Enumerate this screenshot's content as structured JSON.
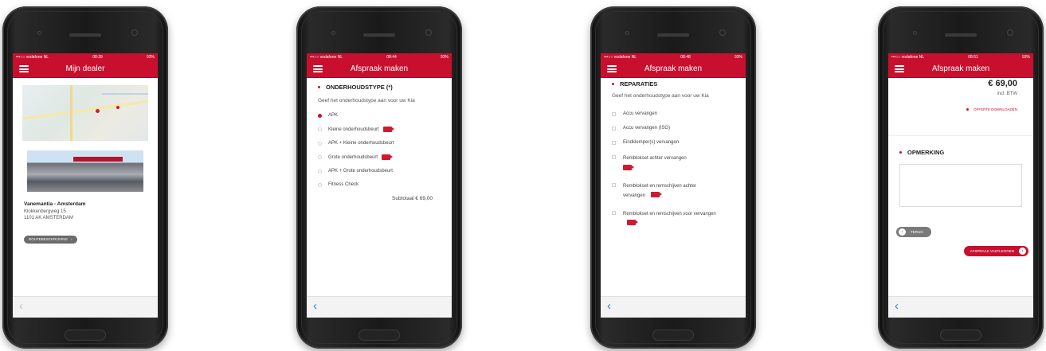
{
  "colors": {
    "accent": "#c8102e",
    "link_blue": "#2a7de1",
    "background": "#ffffff"
  },
  "phones": [
    {
      "status": {
        "left": "•••○○ vodafone NL",
        "time": "08:39",
        "right": "93%"
      },
      "title": "Mijn dealer",
      "dealer": {
        "name": "Vanemantia - Amsterdam",
        "street": "Klokkenbergweg 15",
        "city": "1101 AK AMSTERDAM",
        "route_button": "ROUTEBESCHRIJVING"
      }
    },
    {
      "status": {
        "left": "•••○○ vodafone NL",
        "time": "08:44",
        "right": "93%"
      },
      "title": "Afspraak maken",
      "section_title": "ONDERHOUDSTYPE (*)",
      "description": "Geef het onderhoudstype aan voor uw Kia",
      "options": [
        {
          "label": "APK",
          "selected": true,
          "video": false
        },
        {
          "label": "Kleine onderhoudsbeurt",
          "selected": false,
          "video": true
        },
        {
          "label": "APK + Kleine onderhoudsbeurt",
          "selected": false,
          "video": false
        },
        {
          "label": "Grote onderhoudsbeurt",
          "selected": false,
          "video": true
        },
        {
          "label": "APK + Grote onderhoudsbeurt",
          "selected": false,
          "video": false
        },
        {
          "label": "Fitness Check",
          "selected": false,
          "video": false
        }
      ],
      "subtotal": "Subtotaal € 69,00"
    },
    {
      "status": {
        "left": "•••○○ vodafone NL",
        "time": "08:48",
        "right": "93%"
      },
      "title": "Afspraak maken",
      "section_title": "REPARATIES",
      "description": "Geef het onderhoudstype aan voor uw Kia",
      "items": [
        {
          "label": "Accu vervangen",
          "video": false
        },
        {
          "label": "Accu vervangen (ISG)",
          "video": false
        },
        {
          "label": "Eindklemper(s) vervangen",
          "video": false
        },
        {
          "label": "Remblokset achter vervangen",
          "video": true
        },
        {
          "label": "Remblokset en remschijven achter vervangen",
          "video": true
        },
        {
          "label": "Remblokset en remschijven voor vervangen",
          "video": true
        }
      ]
    },
    {
      "status": {
        "left": "•••○○ vodafone NL",
        "time": "08:51",
        "right": "93%"
      },
      "title": "Afspraak maken",
      "price": "€ 69,00",
      "price_note": "incl. BTW",
      "quote_link": "OFFERTE DOWNLOADEN",
      "remark_title": "OPMERKING",
      "back_button": "TERUG",
      "confirm_button": "AFSPRAAK VASTLEGGEN"
    }
  ]
}
